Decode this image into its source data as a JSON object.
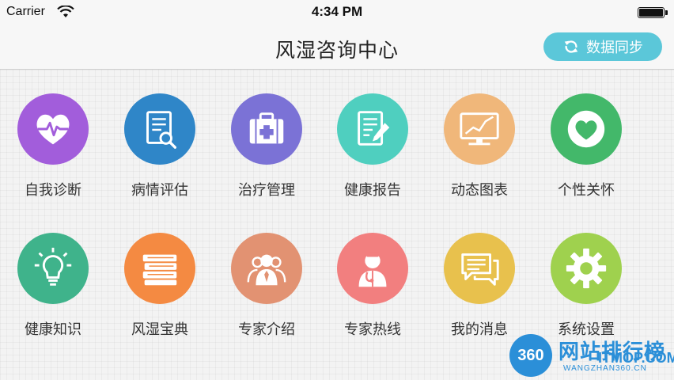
{
  "status_bar": {
    "carrier": "Carrier",
    "time": "4:34 PM"
  },
  "nav": {
    "title": "风湿咨询中心",
    "sync_label": "数据同步"
  },
  "tiles": [
    {
      "label": "自我诊断",
      "color": "#a25ddb",
      "icon": "heart-pulse-icon"
    },
    {
      "label": "病情评估",
      "color": "#2f86c8",
      "icon": "report-magnifier-icon"
    },
    {
      "label": "治疗管理",
      "color": "#7b72d6",
      "icon": "medical-kit-icon"
    },
    {
      "label": "健康报告",
      "color": "#4fcfbf",
      "icon": "report-pen-icon"
    },
    {
      "label": "动态图表",
      "color": "#f0b77a",
      "icon": "chart-monitor-icon"
    },
    {
      "label": "个性关怀",
      "color": "#43b86a",
      "icon": "heart-icon"
    },
    {
      "label": "健康知识",
      "color": "#3fb38b",
      "icon": "lightbulb-icon"
    },
    {
      "label": "风湿宝典",
      "color": "#f48a42",
      "icon": "books-icon"
    },
    {
      "label": "专家介绍",
      "color": "#e29272",
      "icon": "experts-icon"
    },
    {
      "label": "专家热线",
      "color": "#f27f7f",
      "icon": "doctor-icon"
    },
    {
      "label": "我的消息",
      "color": "#e8c14d",
      "icon": "messages-icon"
    },
    {
      "label": "系统设置",
      "color": "#9fd14e",
      "icon": "gear-icon"
    }
  ],
  "watermark": {
    "logo": "360",
    "text": "网站排行榜",
    "sub": "ITMOP.COM",
    "url": "WANGZHAN360.CN"
  },
  "colors": {
    "accent": "#5bc7d9",
    "watermark": "#2b8fd8"
  }
}
